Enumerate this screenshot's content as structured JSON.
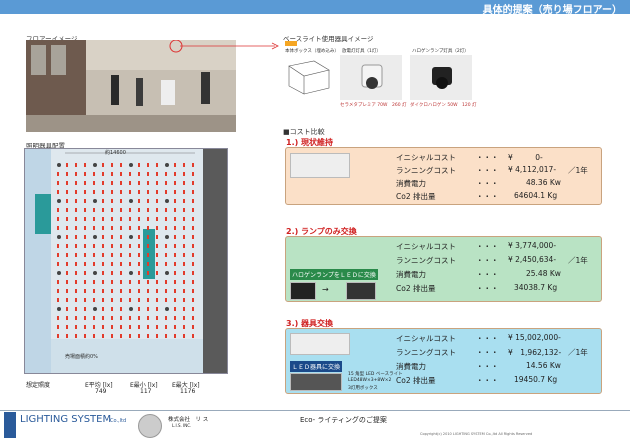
{
  "header": {
    "title": "具体的提案（売り場フロアー）",
    "color": "#5a9ad5"
  },
  "left": {
    "floor_image_label": "フロアーイメージ",
    "plan_label": "照明器具配置",
    "plan_dim": "約14600",
    "plan_note": "売場面積約0%",
    "lux": {
      "label": "想定照度",
      "items": [
        {
          "name": "E平均 [lx]",
          "value": "749"
        },
        {
          "name": "E最小 [lx]",
          "value": "117"
        },
        {
          "name": "E最大 [lx]",
          "value": "1176"
        }
      ]
    }
  },
  "base": {
    "title": "ベースライト使用器具イメージ",
    "items": [
      {
        "label": "本体ボックス（埋め込み）"
      },
      {
        "label": "放電灯灯具（1灯）",
        "caption": "セラメタプレミア 70W　260 灯"
      },
      {
        "label": "ハロゲンランプ灯具（2灯）",
        "caption": "ダイクロハロゲン 50W　120 灯"
      }
    ]
  },
  "cost": {
    "heading": "■コスト比較",
    "sections": [
      {
        "title": "1.) 現状維持",
        "bg": "#fbe0c8",
        "rows": [
          {
            "k": "イニシャルコスト",
            "d": "・・・",
            "v": "¥　　　0-",
            "u": ""
          },
          {
            "k": "ランニングコスト",
            "d": "・・・",
            "v": "¥ 4,112,017-",
            "u": "／1年"
          },
          {
            "k": "消費電力",
            "d": "・・・",
            "v": "48.36 Kw",
            "u": ""
          },
          {
            "k": "Co2 排出量",
            "d": "・・・",
            "v": "64604.1 Kg",
            "u": ""
          }
        ]
      },
      {
        "title": "2.) ランプのみ交換",
        "bg": "#b9e3c4",
        "note": "ハロゲンランプをＬＥＤに交換",
        "rows": [
          {
            "k": "イニシャルコスト",
            "d": "・・・",
            "v": "¥ 3,774,000-",
            "u": ""
          },
          {
            "k": "ランニングコスト",
            "d": "・・・",
            "v": "¥ 2,450,634-",
            "u": "／1年"
          },
          {
            "k": "消費電力",
            "d": "・・・",
            "v": "25.48 Kw",
            "u": ""
          },
          {
            "k": "Co2 排出量",
            "d": "・・・",
            "v": "34038.7 Kg",
            "u": ""
          }
        ]
      },
      {
        "title": "3.) 器具交換",
        "bg": "#a9dff0",
        "note": "ＬＥＤ器具に交換",
        "sub": [
          "15 角型 LED ベースライト",
          "LED48W×3+8W×2",
          "3灯用ボックス"
        ],
        "rows": [
          {
            "k": "イニシャルコスト",
            "d": "・・・",
            "v": "¥ 15,002,000-",
            "u": ""
          },
          {
            "k": "ランニングコスト",
            "d": "・・・",
            "v": "¥　1,962,132-",
            "u": "／1年"
          },
          {
            "k": "消費電力",
            "d": "・・・",
            "v": "14.56 Kw",
            "u": ""
          },
          {
            "k": "Co2 排出量",
            "d": "・・・",
            "v": "19450.7 Kg",
            "u": ""
          }
        ]
      }
    ]
  },
  "footer": {
    "brand": "LIGHTING SYSTEM",
    "brand_suffix": "Co.,ltd",
    "partner": "株式会社　リ ス",
    "partner_sub": "L.I.S. INC.",
    "doc_title": "Eco- ライティングのご提案",
    "copyright": "Copyright(c) 2010 LIGHTING SYSTEM Co.,ltd All Rights Reserved"
  }
}
